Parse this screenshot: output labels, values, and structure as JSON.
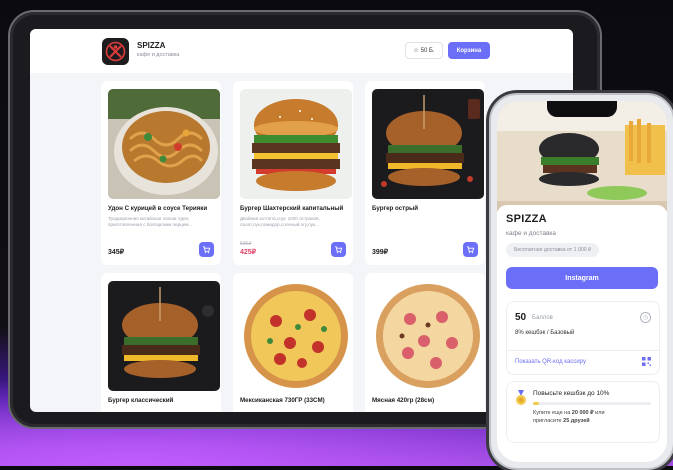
{
  "header": {
    "brand": "SPIZZA",
    "tagline": "кафе и доставка",
    "points_label": "50 Б.",
    "cart_label": "Корзина"
  },
  "products": [
    {
      "title": "Удон С курицей в соусе Терияки",
      "desc": "Традиционная китайская лапша Удон, приготовленная с болгарским перцем...",
      "old_price": "",
      "price": "345₽",
      "image": "noodle-bowl"
    },
    {
      "title": "Бургер Шахтерский капитальный",
      "desc": "Двойная котлета,соус 1000 островов, салат,лук,помидор,соленый огу,лук...",
      "old_price": "505₽",
      "price": "425₽",
      "image": "burger-double"
    },
    {
      "title": "Бургер острый",
      "desc": "",
      "old_price": "",
      "price": "399₽",
      "image": "burger-spicy"
    },
    {
      "title": "Бургер классический",
      "desc": "",
      "old_price": "",
      "price": "",
      "image": "burger-classic"
    },
    {
      "title": "Мексиканская 730ГР (33СМ)",
      "desc": "",
      "old_price": "",
      "price": "",
      "image": "pizza-mexican"
    },
    {
      "title": "Мясная 420гр (28см)",
      "desc": "",
      "old_price": "",
      "price": "",
      "image": "pizza-meat"
    }
  ],
  "phone": {
    "brand": "SPIZZA",
    "tagline": "кафе и доставка",
    "delivery_badge": "Бесплатная доставка от 1 000 ₽",
    "instagram_label": "Instagram",
    "bonus": {
      "points": "50",
      "points_unit": "Баллов",
      "cashback": "8% кешбэк / Базовый",
      "qr_link": "Показать QR-код кассиру"
    },
    "level": {
      "title": "Повысьте кешбэк до 10%",
      "progress": 0.05,
      "line1_prefix": "Купите еще на ",
      "line1_amount": "20 000 ₽",
      "line1_suffix": " или",
      "line2_prefix": "пригласите ",
      "line2_amount": "25 друзей"
    }
  },
  "colors": {
    "accent": "#6b6ef7",
    "sale": "#e0446a",
    "medal": "#f2c94c"
  }
}
